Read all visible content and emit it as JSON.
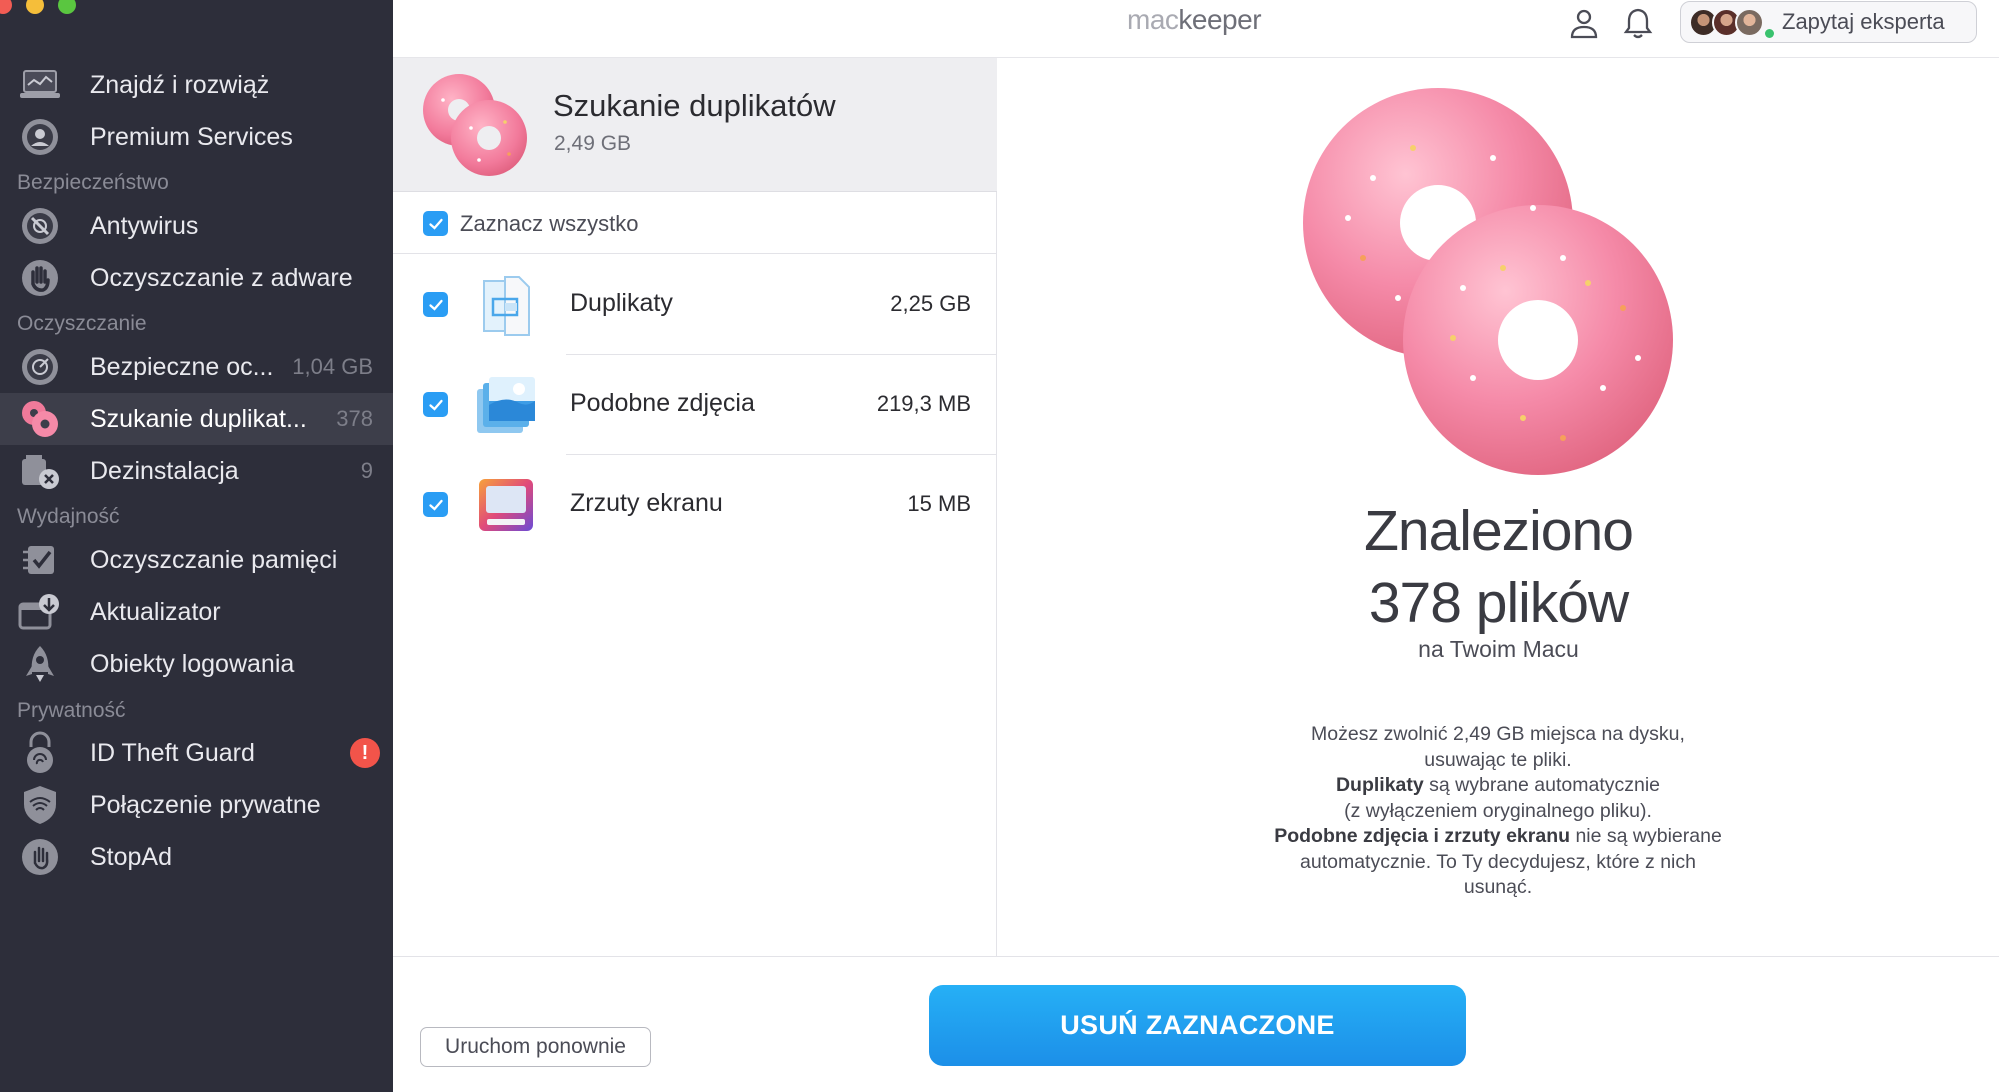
{
  "app": {
    "logo_mac": "mac",
    "logo_keeper": "keeper"
  },
  "header": {
    "expert_label": "Zapytaj eksperta"
  },
  "sidebar": {
    "items": [
      {
        "label": "Znajdź i rozwiąż",
        "icon": "laptop-icon"
      },
      {
        "label": "Premium Services",
        "icon": "headset-icon"
      },
      {
        "label": "Antywirus",
        "icon": "antivirus-icon"
      },
      {
        "label": "Oczyszczanie z adware",
        "icon": "hand-stop-icon"
      },
      {
        "label": "Bezpieczne oc...",
        "count": "1,04 GB",
        "icon": "disk-cleanup-icon"
      },
      {
        "label": "Szukanie duplikat...",
        "count": "378",
        "icon": "donut-icon",
        "active": true
      },
      {
        "label": "Dezinstalacja",
        "count": "9",
        "icon": "uninstall-icon"
      },
      {
        "label": "Oczyszczanie pamięci",
        "icon": "memory-chip-icon"
      },
      {
        "label": "Aktualizator",
        "icon": "updater-icon"
      },
      {
        "label": "Obiekty logowania",
        "icon": "rocket-icon"
      },
      {
        "label": "ID Theft Guard",
        "icon": "fingerprint-lock-icon",
        "badge": "!"
      },
      {
        "label": "Połączenie prywatne",
        "icon": "vpn-shield-icon"
      },
      {
        "label": "StopAd",
        "icon": "stopad-hand-icon"
      }
    ],
    "sections": [
      "Bezpieczeństwo",
      "Oczyszczanie",
      "Wydajność",
      "Prywatność"
    ]
  },
  "panel": {
    "title": "Szukanie duplikatów",
    "size": "2,49 GB",
    "select_all": "Zaznacz wszystko",
    "rows": [
      {
        "label": "Duplikaty",
        "size": "2,25 GB",
        "checked": true,
        "icon": "duplicate-file-icon"
      },
      {
        "label": "Podobne zdjęcia",
        "size": "219,3 MB",
        "checked": true,
        "icon": "similar-photos-icon"
      },
      {
        "label": "Zrzuty ekranu",
        "size": "15 MB",
        "checked": true,
        "icon": "screenshot-icon"
      }
    ]
  },
  "result": {
    "line1": "Znaleziono",
    "line2": "378 plików",
    "line3": "na Twoim Macu",
    "desc": {
      "p1": "Możesz zwolnić 2,49 GB miejsca na dysku,",
      "p2": "usuwając te pliki.",
      "p3_bold": "Duplikaty",
      "p3_rest": " są wybrane automatycznie",
      "p4": "(z wyłączeniem oryginalnego pliku).",
      "p5_bold": "Podobne zdjęcia i zrzuty ekranu",
      "p5_rest": " nie są wybierane",
      "p6": "automatycznie. To Ty decydujesz, które z nich",
      "p7": "usunąć."
    }
  },
  "footer": {
    "restart": "Uruchom ponownie",
    "remove": "USUŃ ZAZNACZONE"
  },
  "colors": {
    "sidebar_bg": "#2d2e3a",
    "accent": "#2a9df4",
    "alert": "#f2544a",
    "donut": "#f58aa8"
  }
}
